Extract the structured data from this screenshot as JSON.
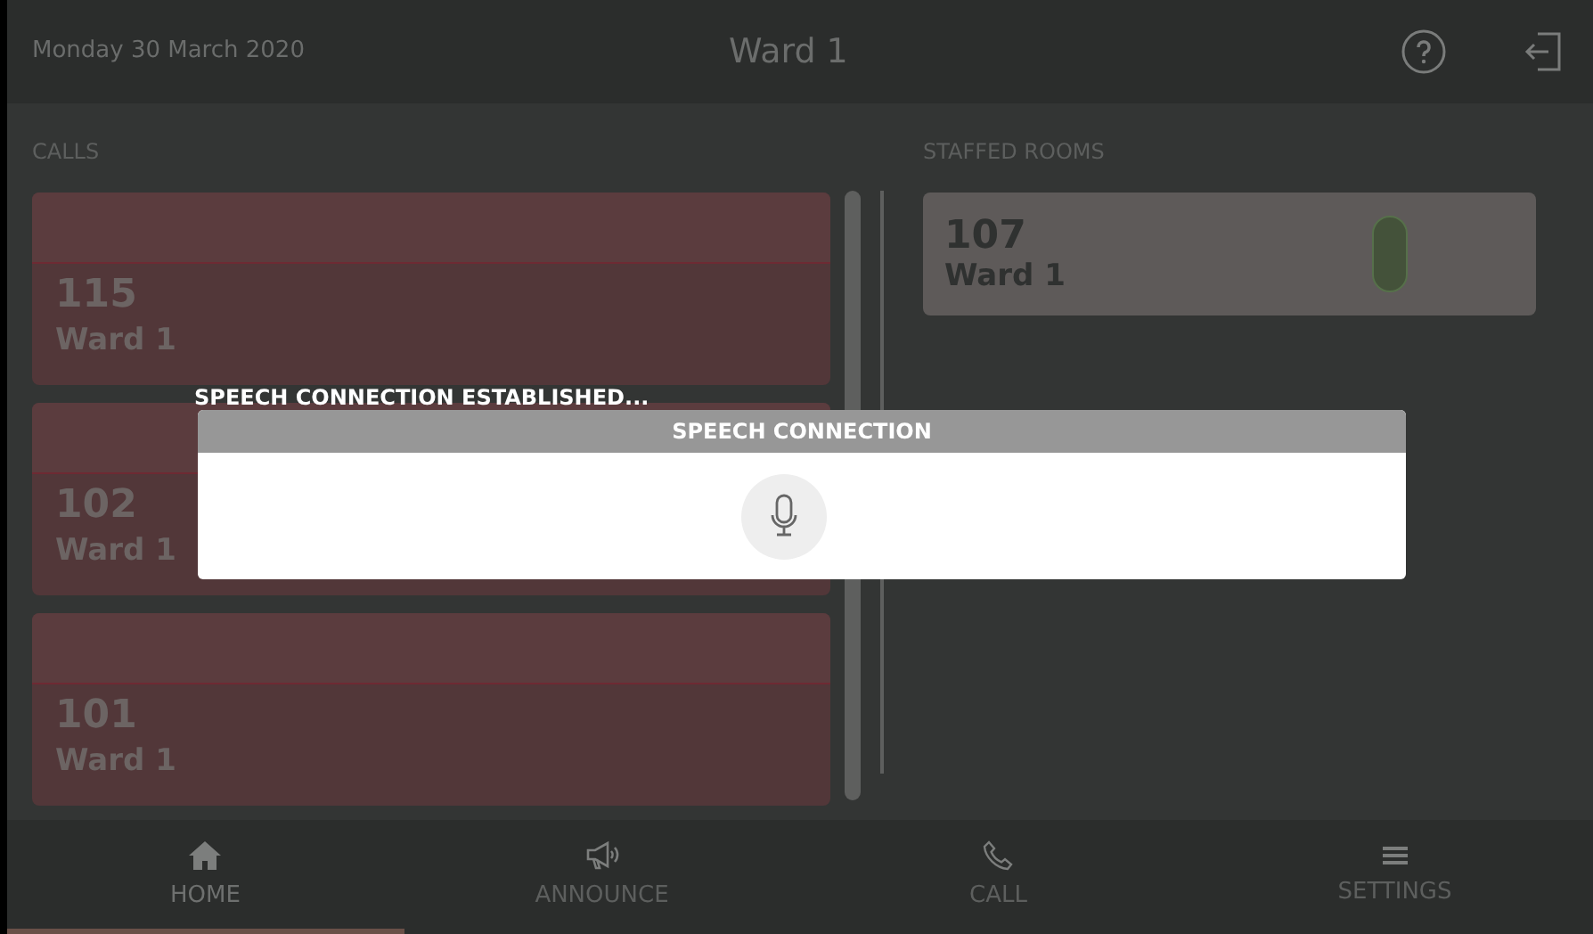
{
  "header": {
    "date": "Monday 30 March 2020",
    "title": "Ward 1"
  },
  "calls": {
    "heading": "CALLS",
    "items": [
      {
        "room": "115",
        "ward": "Ward 1"
      },
      {
        "room": "102",
        "ward": "Ward 1"
      },
      {
        "room": "101",
        "ward": "Ward 1"
      }
    ]
  },
  "staffed_rooms": {
    "heading": "STAFFED ROOMS",
    "items": [
      {
        "room": "107",
        "ward": "Ward 1"
      }
    ]
  },
  "nav": [
    {
      "kind": "home",
      "label": "HOME",
      "selected": true
    },
    {
      "kind": "announce",
      "label": "ANNOUNCE",
      "selected": false
    },
    {
      "kind": "call",
      "label": "CALL",
      "selected": false
    },
    {
      "kind": "settings",
      "label": "SETTINGS",
      "selected": false
    }
  ],
  "overlay": {
    "status": "SPEECH CONNECTION ESTABLISHED...",
    "dialog_title": "SPEECH CONNECTION"
  }
}
